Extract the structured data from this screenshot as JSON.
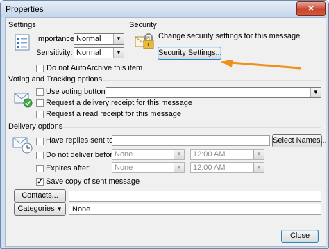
{
  "window": {
    "title": "Properties",
    "close_glyph": "✕"
  },
  "settings": {
    "group_label": "Settings",
    "importance_label": "Importance:",
    "importance_value": "Normal",
    "sensitivity_label": "Sensitivity:",
    "sensitivity_value": "Normal",
    "autoarchive_label": "Do not AutoArchive this item",
    "autoarchive_checked": false
  },
  "security": {
    "group_label": "Security",
    "description": "Change security settings for this message.",
    "button_label": "Security Settings..."
  },
  "voting": {
    "group_label": "Voting and Tracking options",
    "use_voting_label": "Use voting buttons:",
    "voting_value": "",
    "delivery_receipt_label": "Request a delivery receipt for this message",
    "read_receipt_label": "Request a read receipt for this message"
  },
  "delivery": {
    "group_label": "Delivery options",
    "replies_label": "Have replies sent to:",
    "replies_value": "",
    "select_names_label": "Select Names...",
    "do_not_deliver_label": "Do not deliver before:",
    "do_not_deliver_date": "None",
    "do_not_deliver_time": "12:00 AM",
    "expires_label": "Expires after:",
    "expires_date": "None",
    "expires_time": "12:00 AM",
    "save_copy_label": "Save copy of sent message",
    "save_copy_checked": true
  },
  "contacts_button_label": "Contacts...",
  "categories_button_label": "Categories",
  "categories_value": "None",
  "close_button_label": "Close",
  "check_glyph": "✓",
  "dropdown_glyph": "▼",
  "icons": {
    "settings": "settings-list-icon",
    "security": "padlock-envelope-icon",
    "voting": "voting-envelope-icon",
    "delivery": "delivery-envelope-icon",
    "annotation": "orange-arrow"
  },
  "colors": {
    "annotation_arrow": "#f0901a",
    "default_button_border": "#3c7fb1"
  }
}
